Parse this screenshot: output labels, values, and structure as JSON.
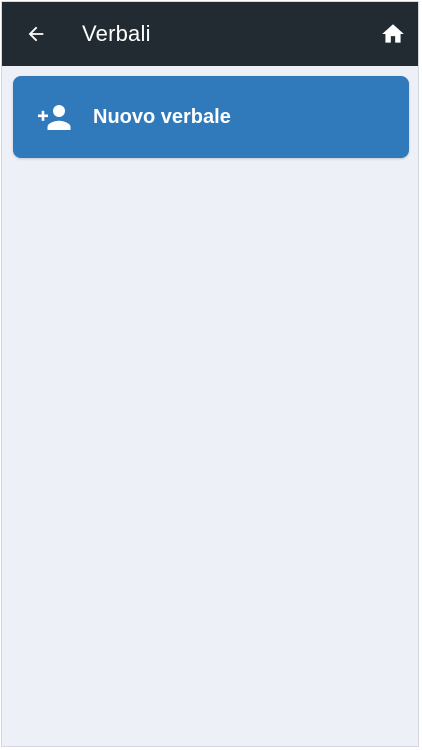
{
  "header": {
    "title": "Verbali",
    "back_icon": "arrow-left-icon",
    "home_icon": "home-icon",
    "background_color": "#212b31"
  },
  "main": {
    "new_button": {
      "label": "Nuovo verbale",
      "icon": "person-add-icon",
      "color": "#3079ba"
    },
    "background_color": "#eef0f8"
  }
}
